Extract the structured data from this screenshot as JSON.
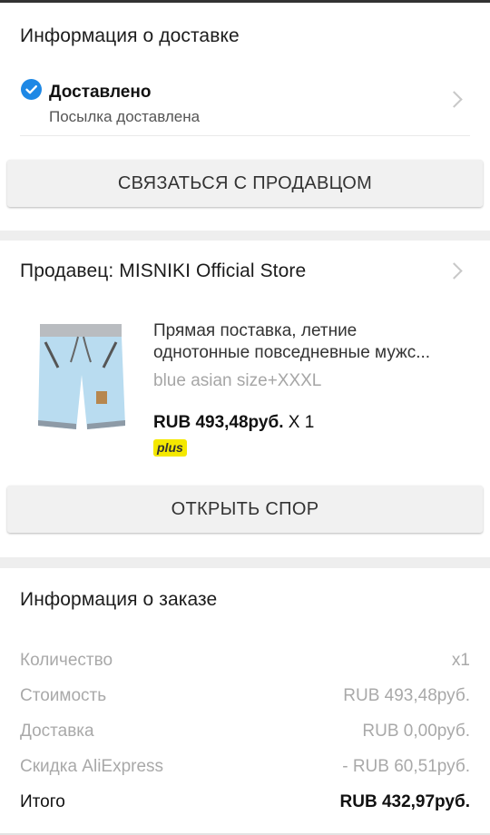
{
  "delivery": {
    "title": "Информация о доставке",
    "status": "Доставлено",
    "status_detail": "Посылка доставлена",
    "status_color": "#1e88e5",
    "contact_button": "СВЯЗАТЬСЯ С ПРОДАВЦОМ"
  },
  "seller": {
    "label": "Продавец: MISNIKI Official Store",
    "product": {
      "title_line1": "Прямая поставка, летние",
      "title_line2": "однотонные повседневные мужс...",
      "variant": "blue asian size+XXXL",
      "price": "RUB 493,48руб.",
      "quantity": " X 1",
      "badge": "plus",
      "badge_color": "#f4e800"
    },
    "dispute_button": "ОТКРЫТЬ СПОР"
  },
  "order": {
    "title": "Информация о заказе",
    "rows": [
      {
        "label": "Количество",
        "value": "x1"
      },
      {
        "label": "Стоимость",
        "value": "RUB 493,48руб."
      },
      {
        "label": "Доставка",
        "value": "RUB 0,00руб."
      },
      {
        "label": "Скидка AliExpress",
        "value": "- RUB 60,51руб."
      }
    ],
    "total": {
      "label": "Итого",
      "value": "RUB 432,97руб."
    }
  }
}
